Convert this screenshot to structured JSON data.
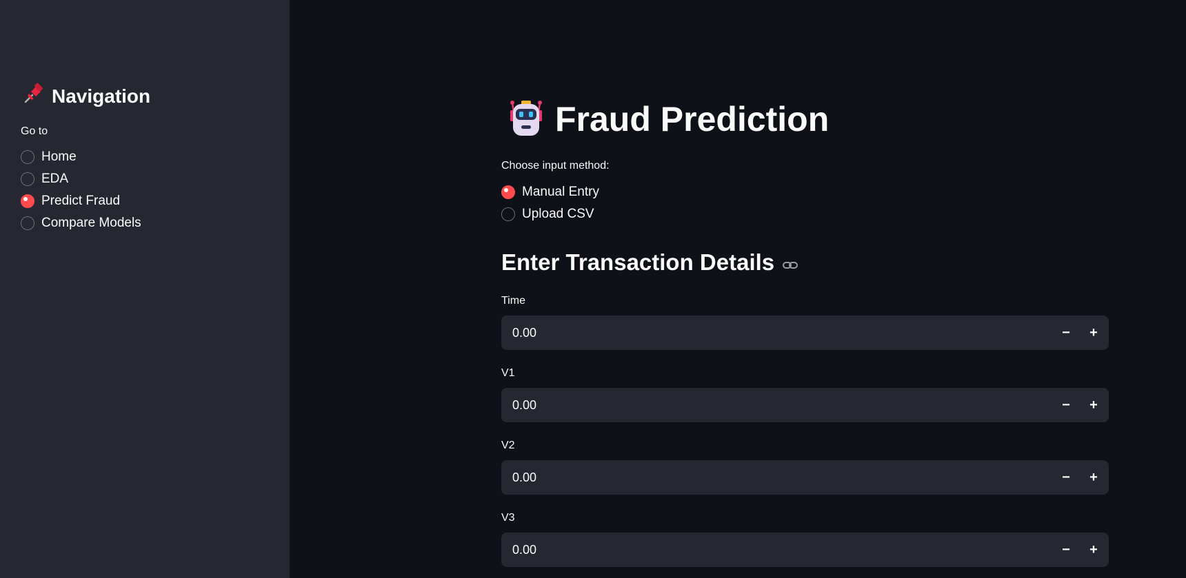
{
  "sidebar": {
    "title": "Navigation",
    "title_icon": "pushpin-icon",
    "goto_label": "Go to",
    "items": [
      {
        "label": "Home",
        "selected": false
      },
      {
        "label": "EDA",
        "selected": false
      },
      {
        "label": "Predict Fraud",
        "selected": true
      },
      {
        "label": "Compare Models",
        "selected": false
      }
    ]
  },
  "main": {
    "title": "Fraud Prediction",
    "title_icon": "robot-icon",
    "input_method": {
      "label": "Choose input method:",
      "options": [
        {
          "label": "Manual Entry",
          "selected": true
        },
        {
          "label": "Upload CSV",
          "selected": false
        }
      ]
    },
    "section_title": "Enter Transaction Details",
    "section_icon": "link-icon",
    "fields": [
      {
        "label": "Time",
        "value": "0.00"
      },
      {
        "label": "V1",
        "value": "0.00"
      },
      {
        "label": "V2",
        "value": "0.00"
      },
      {
        "label": "V3",
        "value": "0.00"
      }
    ],
    "stepper": {
      "minus": "−",
      "plus": "+"
    }
  },
  "colors": {
    "background": "#0e1117",
    "sidebar": "#262730",
    "accent": "#ff4b4b",
    "input_bg": "#262730"
  }
}
